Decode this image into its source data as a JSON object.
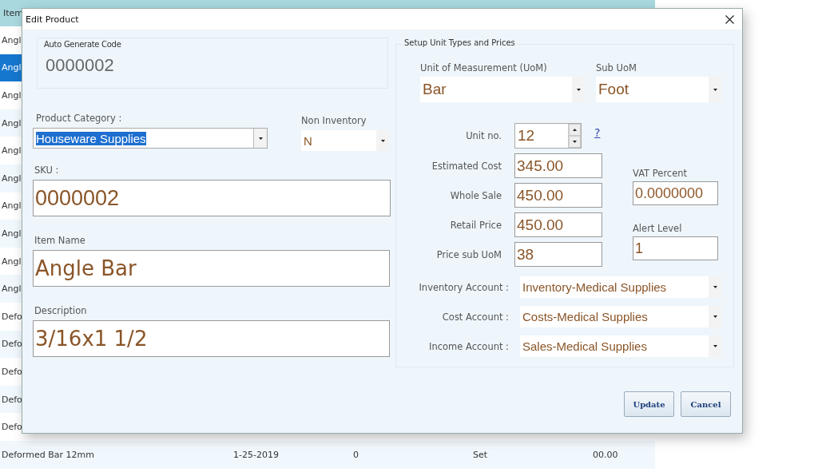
{
  "background_table": {
    "header": "Item",
    "rows": [
      {
        "cell_1": "Angl",
        "selected": false
      },
      {
        "cell_1": "Angl",
        "selected": true
      },
      {
        "cell_1": "Angl",
        "selected": false
      },
      {
        "cell_1": "Angl",
        "selected": false
      },
      {
        "cell_1": "Angl",
        "selected": false
      },
      {
        "cell_1": "Angl",
        "selected": false
      },
      {
        "cell_1": "Angl",
        "selected": false
      },
      {
        "cell_1": "Angl",
        "selected": false
      },
      {
        "cell_1": "Angl",
        "selected": false
      },
      {
        "cell_1": "Angl",
        "selected": false
      },
      {
        "cell_1": "Defo",
        "selected": false
      },
      {
        "cell_1": "Defo",
        "selected": false
      },
      {
        "cell_1": "Defo",
        "selected": false
      },
      {
        "cell_1": "Defo",
        "selected": false
      },
      {
        "cell_1": "Defo",
        "selected": false
      },
      {
        "cell_1": "Deformed Bar 12mm",
        "cell_2": "1-25-2019",
        "cell_3": "0",
        "cell_4": "Set",
        "cell_5": "00.00",
        "selected": false
      }
    ]
  },
  "dialog": {
    "title": "Edit Product",
    "auto_code": {
      "label": "Auto Generate Code",
      "value": "0000002"
    },
    "product_category": {
      "label": "Product Category :",
      "value": "Houseware Supplies",
      "text_selected": true
    },
    "non_inventory": {
      "label": "Non Inventory",
      "value": "N"
    },
    "sku": {
      "label": "SKU :",
      "value": "0000002"
    },
    "item_name": {
      "label": "Item Name",
      "value": "Angle Bar"
    },
    "description": {
      "label": "Description",
      "value": "3/16x1 1/2"
    },
    "unit_setup": {
      "legend": "Setup Unit Types and Prices",
      "uom": {
        "label": "Unit of Measurement (UoM)",
        "value": "Bar"
      },
      "sub_uom": {
        "label": "Sub UoM",
        "value": "Foot"
      },
      "unit_no": {
        "label": "Unit no.",
        "value": "12",
        "help": "?"
      },
      "prices": [
        {
          "label": "Estimated Cost",
          "value": "345.00"
        },
        {
          "label": "Whole Sale",
          "value": "450.00"
        },
        {
          "label": "Retail Price",
          "value": "450.00"
        },
        {
          "label": "Price sub UoM",
          "value": "38"
        }
      ],
      "vat_percent": {
        "label": "VAT Percent",
        "value": "0.0000000"
      },
      "alert_level": {
        "label": "Alert Level",
        "value": "1"
      },
      "accounts": [
        {
          "label": "Inventory Account :",
          "value": "Inventory-Medical Supplies"
        },
        {
          "label": "Cost Account :",
          "value": "Costs-Medical Supplies"
        },
        {
          "label": "Income Account :",
          "value": "Sales-Medical Supplies"
        }
      ]
    },
    "buttons": [
      "Update",
      "Cancel"
    ]
  }
}
